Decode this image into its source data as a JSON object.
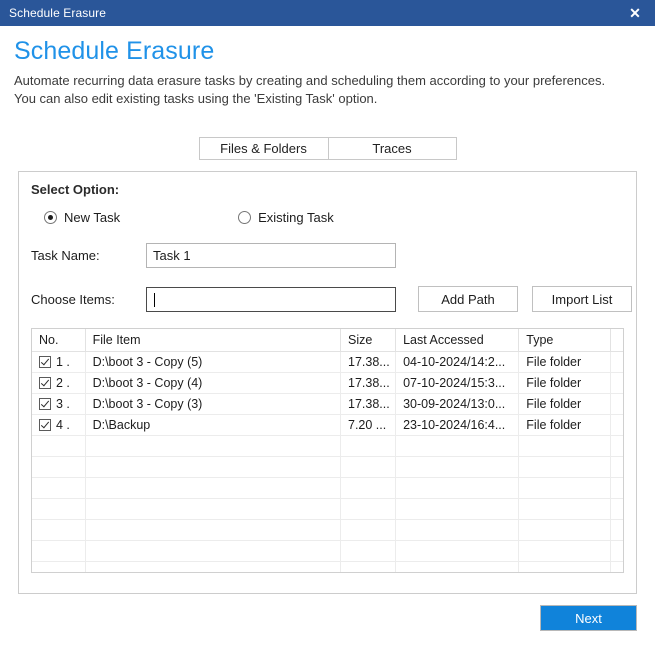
{
  "titlebar": {
    "title": "Schedule Erasure",
    "close_label": "✕",
    "close_icon": "close-icon",
    "bg_color": "#2a5699"
  },
  "header": {
    "title": "Schedule Erasure",
    "title_color": "#2092e8",
    "subtitle_line1": "Automate recurring data erasure tasks by creating and scheduling them according to your preferences.",
    "subtitle_line2": "You can also edit existing tasks using the 'Existing Task' option."
  },
  "tabs": [
    {
      "label": "Files & Folders",
      "selected": true
    },
    {
      "label": "Traces",
      "selected": false
    }
  ],
  "panel": {
    "title": "Select Option:",
    "radios": [
      {
        "label": "New Task",
        "checked": true
      },
      {
        "label": "Existing Task",
        "checked": false
      }
    ],
    "task_name": {
      "label": "Task Name:",
      "value": "Task 1",
      "placeholder": ""
    },
    "choose_items": {
      "label": "Choose Items:",
      "value": "",
      "placeholder": "",
      "focused": true
    },
    "buttons": {
      "add_path": "Add Path",
      "import_list": "Import List"
    }
  },
  "table": {
    "columns": [
      "No.",
      "File Item",
      "Size",
      "Last Accessed",
      "Type"
    ],
    "rows": [
      {
        "checked": true,
        "no": "1 .",
        "file_item": "D:\\boot 3 - Copy (5)",
        "size": "17.38...",
        "last_accessed": "04-10-2024/14:2...",
        "type": "File folder"
      },
      {
        "checked": true,
        "no": "2 .",
        "file_item": "D:\\boot 3 - Copy (4)",
        "size": "17.38...",
        "last_accessed": "07-10-2024/15:3...",
        "type": "File folder"
      },
      {
        "checked": true,
        "no": "3 .",
        "file_item": "D:\\boot 3 - Copy (3)",
        "size": "17.38...",
        "last_accessed": "30-09-2024/13:0...",
        "type": "File folder"
      },
      {
        "checked": true,
        "no": "4 .",
        "file_item": "D:\\Backup",
        "size": "7.20 ...",
        "last_accessed": "23-10-2024/16:4...",
        "type": "File folder"
      }
    ],
    "empty_row_count": 10
  },
  "footer": {
    "next_label": "Next",
    "next_color": "#1083da"
  }
}
